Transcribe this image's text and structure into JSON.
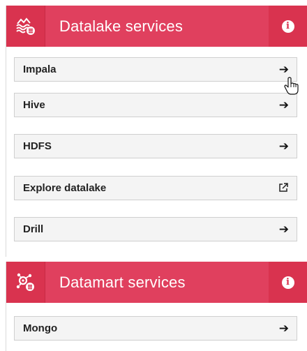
{
  "colors": {
    "header_bg": "#e0405e",
    "header_icon_bg": "#d9334f",
    "item_bg": "#f4f4f4",
    "item_border": "#cfcfcf"
  },
  "datalake": {
    "title": "Datalake services",
    "icon": "datalake-waves-icon",
    "info_icon": "info-icon",
    "items": [
      {
        "label": "Impala",
        "icon": "arrow-right-icon"
      },
      {
        "label": "Hive",
        "icon": "arrow-right-icon"
      },
      {
        "label": "HDFS",
        "icon": "arrow-right-icon"
      },
      {
        "label": "Explore datalake",
        "icon": "external-link-icon"
      },
      {
        "label": "Drill",
        "icon": "arrow-right-icon"
      }
    ]
  },
  "datamart": {
    "title": "Datamart services",
    "icon": "datamart-nodes-icon",
    "info_icon": "info-icon",
    "items": [
      {
        "label": "Mongo",
        "icon": "arrow-right-icon"
      }
    ]
  }
}
